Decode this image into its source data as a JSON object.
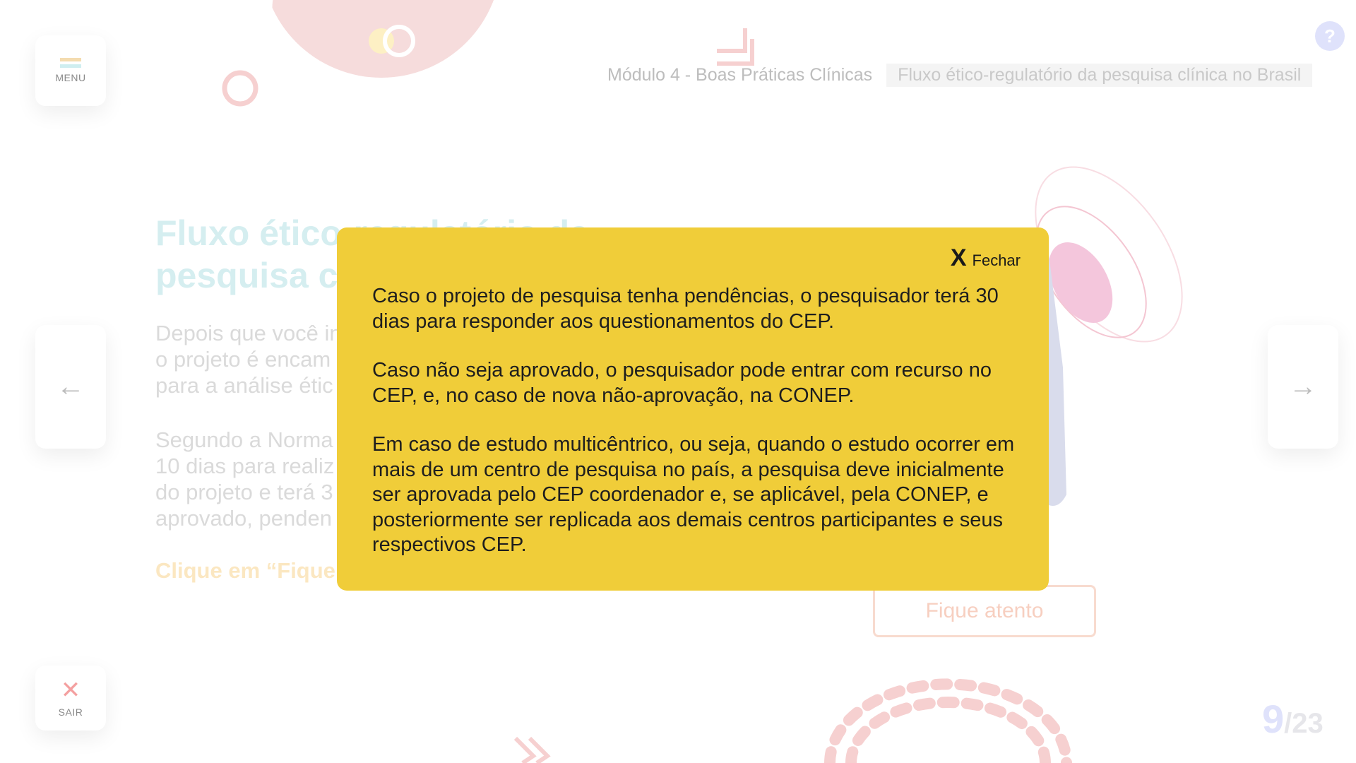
{
  "nav": {
    "menu_label": "MENU",
    "exit_label": "SAIR",
    "exit_glyph": "✕",
    "prev_glyph": "←",
    "next_glyph": "→",
    "help_glyph": "?"
  },
  "header": {
    "module": "Módulo 4 - Boas Práticas Clínicas",
    "topic": "Fluxo ético-regulatório da pesquisa clínica no Brasil"
  },
  "background": {
    "title_line1": "Fluxo ético-regulatório da",
    "title_line2": "pesquisa cl",
    "para1_line1": "Depois que você in",
    "para1_line2": "o projeto é encam",
    "para1_line3": "para a análise étic",
    "para2_line1": "Segundo a Norma",
    "para2_line2": "10 dias para realiz",
    "para2_line3": "do projeto e terá 3",
    "para2_line4": "aprovado, penden",
    "cta": "Clique em “Fique",
    "fique_button": "Fique atento"
  },
  "modal": {
    "close_glyph": "X",
    "close_label": "Fechar",
    "paragraphs": [
      "Caso o projeto de pesquisa tenha pendências, o pesquisador terá 30 dias para responder aos questionamentos do CEP.",
      "Caso não seja aprovado, o pesquisador pode entrar com recurso no CEP, e, no caso de nova não-aprovação, na CONEP.",
      "Em caso de estudo multicêntrico, ou seja, quando o estudo ocorrer em mais de um centro de pesquisa no país, a pesquisa deve inicialmente ser aprovada pelo CEP coordenador e, se aplicável, pela CONEP, e posteriormente ser replicada aos demais centros participantes e seus respectivos CEP."
    ]
  },
  "pagination": {
    "current": "9",
    "total": "/23"
  },
  "colors": {
    "modal_bg": "#f0cd39",
    "help_button": "#dfe2fb",
    "exit_icon": "#f4a0a0"
  }
}
